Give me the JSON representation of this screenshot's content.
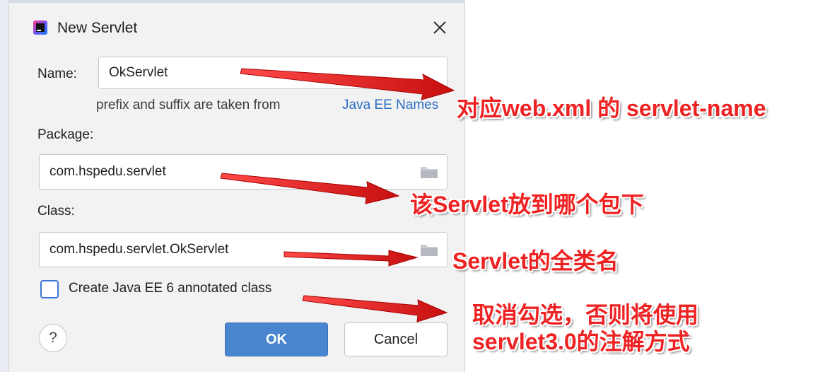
{
  "dialog": {
    "title": "New Servlet",
    "name_label": "Name:",
    "name_value": "OkServlet",
    "hint_text": "prefix and suffix are taken from",
    "hint_link": "Java EE Names",
    "package_label": "Package:",
    "package_value": "com.hspedu.servlet",
    "class_label": "Class:",
    "class_value": "com.hspedu.servlet.OkServlet",
    "checkbox_label": "Create Java EE 6 annotated class",
    "checkbox_checked": false,
    "help_label": "?",
    "ok_label": "OK",
    "cancel_label": "Cancel"
  },
  "annotations": {
    "name_note": "对应web.xml 的 servlet-name",
    "package_note": "该Servlet放到哪个包下",
    "class_note": "Servlet的全类名",
    "checkbox_note_line1": "取消勾选，否则将使用",
    "checkbox_note_line2": "servlet3.0的注解方式"
  },
  "colors": {
    "annotation_red": "#ee2222",
    "link_blue": "#2b6dc4",
    "primary_button": "#4a86d0",
    "checkbox_border": "#3a78d6"
  },
  "icons": [
    "intellij-app-icon",
    "close-icon",
    "folder-icon",
    "help-icon",
    "arrow-icon"
  ]
}
